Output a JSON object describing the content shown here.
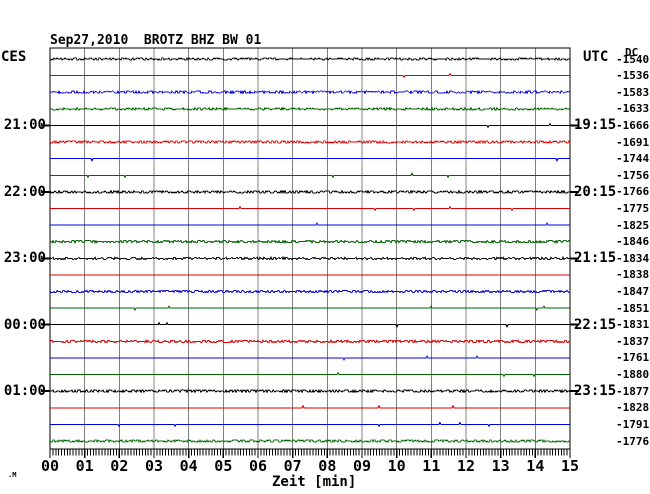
{
  "header": {
    "title": "Sep27,2010  BROTZ BHZ BW 01",
    "left_tz_label": "CES",
    "right_tz_label": "UTC",
    "dc_label": "DC"
  },
  "footer": {
    "corner_mark": ".M"
  },
  "chart_data": {
    "type": "line",
    "subtype": "helicorder-seismogram",
    "title": "Sep27,2010  BROTZ BHZ BW 01",
    "date": "Sep27,2010",
    "station": "BROTZ",
    "channel": "BHZ",
    "network": "BW",
    "location": "01",
    "xlabel": "Zeit [min]",
    "xlim": [
      0,
      15
    ],
    "x_ticks": [
      "00",
      "01",
      "02",
      "03",
      "04",
      "05",
      "06",
      "07",
      "08",
      "09",
      "10",
      "11",
      "12",
      "13",
      "14",
      "15"
    ],
    "minutes_per_trace": 15,
    "grid": "vertical-only",
    "colors": {
      "black": "#000000",
      "red": "#dd0000",
      "blue": "#0000dd",
      "green": "#006600",
      "grid": "#808080",
      "background": "#ffffff"
    },
    "traces": [
      {
        "color": "black",
        "dc": -1540,
        "noise": 2,
        "local_time": null,
        "utc_time": null
      },
      {
        "color": "red",
        "dc": -1536,
        "noise": 1,
        "local_time": null,
        "utc_time": null
      },
      {
        "color": "blue",
        "dc": -1583,
        "noise": 3,
        "local_time": null,
        "utc_time": null
      },
      {
        "color": "green",
        "dc": -1633,
        "noise": 2,
        "local_time": null,
        "utc_time": null
      },
      {
        "color": "black",
        "dc": -1666,
        "noise": 1,
        "local_time": "21:00",
        "utc_time": "19:15"
      },
      {
        "color": "red",
        "dc": -1691,
        "noise": 3,
        "local_time": null,
        "utc_time": null
      },
      {
        "color": "blue",
        "dc": -1744,
        "noise": 1,
        "local_time": null,
        "utc_time": null
      },
      {
        "color": "green",
        "dc": -1756,
        "noise": 1,
        "local_time": null,
        "utc_time": null
      },
      {
        "color": "black",
        "dc": -1766,
        "noise": 3,
        "local_time": "22:00",
        "utc_time": "20:15"
      },
      {
        "color": "red",
        "dc": -1775,
        "noise": 1,
        "local_time": null,
        "utc_time": null
      },
      {
        "color": "blue",
        "dc": -1825,
        "noise": 1,
        "local_time": null,
        "utc_time": null
      },
      {
        "color": "green",
        "dc": -1846,
        "noise": 3,
        "local_time": null,
        "utc_time": null
      },
      {
        "color": "black",
        "dc": -1834,
        "noise": 2,
        "local_time": "23:00",
        "utc_time": "21:15"
      },
      {
        "color": "red",
        "dc": -1838,
        "noise": 1,
        "local_time": null,
        "utc_time": null
      },
      {
        "color": "blue",
        "dc": -1847,
        "noise": 3,
        "local_time": null,
        "utc_time": null
      },
      {
        "color": "green",
        "dc": -1851,
        "noise": 1,
        "local_time": null,
        "utc_time": null
      },
      {
        "color": "black",
        "dc": -1831,
        "noise": 1,
        "local_time": "00:00",
        "utc_time": "22:15"
      },
      {
        "color": "red",
        "dc": -1837,
        "noise": 3,
        "local_time": null,
        "utc_time": null
      },
      {
        "color": "blue",
        "dc": -1761,
        "noise": 1,
        "local_time": null,
        "utc_time": null
      },
      {
        "color": "green",
        "dc": -1880,
        "noise": 1,
        "local_time": null,
        "utc_time": null
      },
      {
        "color": "black",
        "dc": -1877,
        "noise": 3,
        "local_time": "01:00",
        "utc_time": "23:15"
      },
      {
        "color": "red",
        "dc": -1828,
        "noise": 1,
        "local_time": null,
        "utc_time": null
      },
      {
        "color": "blue",
        "dc": -1791,
        "noise": 1,
        "local_time": null,
        "utc_time": null
      },
      {
        "color": "green",
        "dc": -1776,
        "noise": 3,
        "local_time": null,
        "utc_time": null
      }
    ]
  }
}
